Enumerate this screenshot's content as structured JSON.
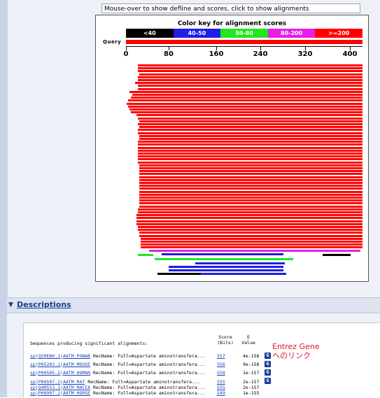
{
  "hint": "Mouse-over to show defline and scores, click to show alignments",
  "graph": {
    "key_title": "Color key for alignment scores",
    "key": [
      {
        "label": "<40",
        "color": "#000000"
      },
      {
        "label": "40-50",
        "color": "#1e1ee6"
      },
      {
        "label": "50-80",
        "color": "#22e622"
      },
      {
        "label": "80-200",
        "color": "#e61ee6"
      },
      {
        "label": ">=200",
        "color": "#ff0000"
      }
    ],
    "query_label": "Query",
    "axis_ticks": [
      "0",
      "80",
      "160",
      "240",
      "320",
      "400"
    ]
  },
  "descriptions": {
    "toggle": "▼",
    "title": "Descriptions",
    "score_header_1": "Score",
    "score_header_2": "(Bits)",
    "e_header_1": "E",
    "e_header_2": "Value",
    "seq_header": "Sequences producing significant alignments:",
    "rows": [
      {
        "acc": "sp|Q5REB0.1|AATM_PONAB",
        "desc": "RecName: Full=Aspartate aminotransfera...",
        "score": "557",
        "evalue": "4e-158",
        "g": "G"
      },
      {
        "acc": "sp|P05202.1|AATM_MOUSE",
        "desc": "RecName: Full=Aspartate aminotransfera...",
        "score": "556",
        "evalue": "9e-158",
        "g": "G"
      },
      {
        "acc": "sp|P00505.2|AATM_HUMAN",
        "desc": "RecName: Full=Aspartate aminotransfera...",
        "score": "558",
        "evalue": "1e-157",
        "g": "G"
      },
      {
        "acc": "sp|P00507.2|AATM_RAT",
        "desc": "RecName: Full=Aspartate aminotransfera...",
        "score": "555",
        "evalue": "2e-157",
        "g": "G"
      },
      {
        "acc": "sp|Q4R553.1|AATM_MACFA",
        "desc": "RecName: Full=Aspartate aminotransfera...",
        "score": "555",
        "evalue": "2e-157",
        "g": ""
      },
      {
        "acc": "sp|P08907.1|AATM_HORSE",
        "desc": "RecName: Full=Aspartate aminotransfera...",
        "score": "549",
        "evalue": "1e-155",
        "g": ""
      }
    ],
    "annotation_line1": "Entrez Gene",
    "annotation_line2": "へのリンク"
  }
}
